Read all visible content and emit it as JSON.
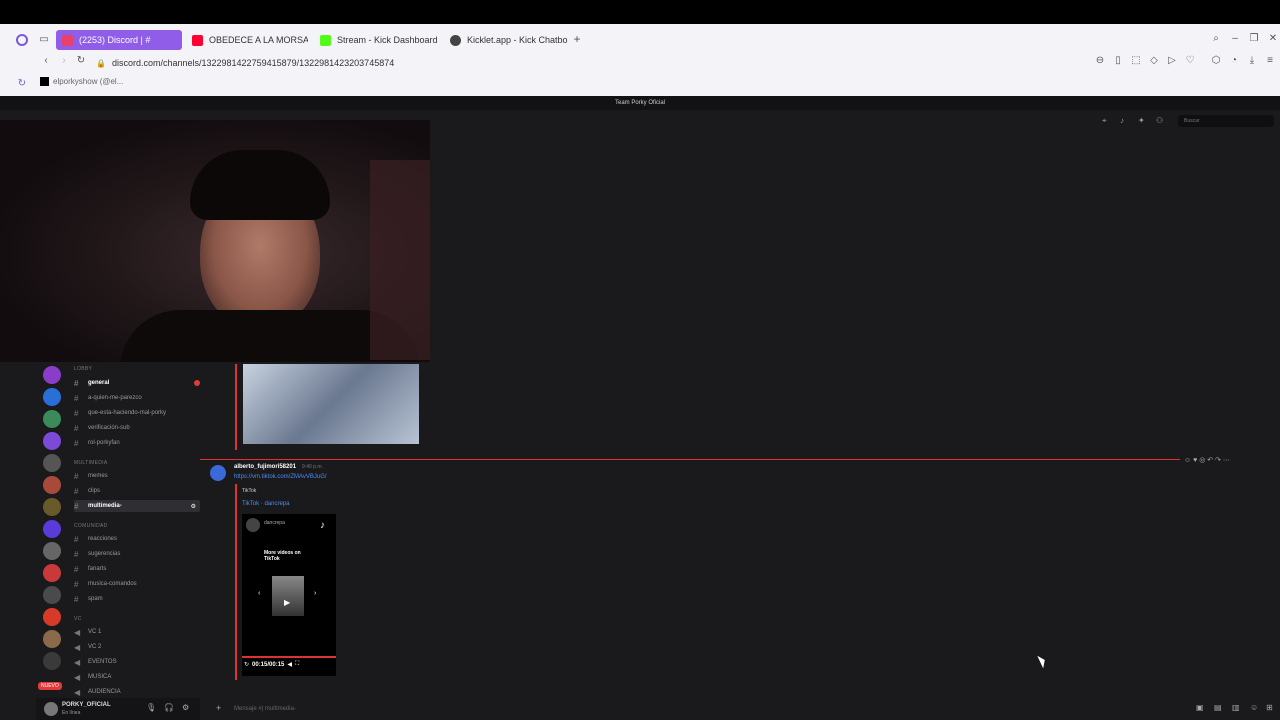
{
  "tabs": [
    {
      "label": "(2253) Discord | #",
      "active": true,
      "color": "#e8426b"
    },
    {
      "label": "OBEDECE A LA MORSA",
      "active": false,
      "color": "#ff0033"
    },
    {
      "label": "Stream - Kick Dashboard",
      "active": false,
      "color": "#53fc18"
    },
    {
      "label": "Kicklet.app - Kick Chatbo",
      "active": false,
      "color": "#444444"
    }
  ],
  "url": "discord.com/channels/1322981422759415879/1322981423203745874",
  "bookmark": "elporkyshow (@el...",
  "discord": {
    "window_title": "Team Porky Oficial",
    "search_placeholder": "Buscar",
    "categories": {
      "lobby": "LOBBY",
      "multimedia": "MULTIMEDIA",
      "comunidad": "COMUNIDAD",
      "vc": "VC"
    },
    "channels": {
      "general": "general",
      "a_quien": "a-quien-me-parezco",
      "que_esta": "que-esta-haciendo-mal-porky",
      "verificacion": "verificación-sub",
      "rol": "rol-porkyfan",
      "memes": "memes",
      "clips": "clips",
      "multimedia": "multimedia-",
      "reacciones": "reacciones",
      "sugerencias": "sugerencias",
      "fanarts": "fanarts",
      "musica": "musica-comandos",
      "spam": "spam",
      "vc1": "VC 1",
      "vc2": "VC 2",
      "eventos": "EVENTOS",
      "musica_vc": "MUSICA",
      "audiencia": "AUDIENCIA"
    },
    "nuevo_badge": "NUEVO",
    "user": {
      "name": "PORKY_OFICIAL",
      "status": "En línea"
    },
    "composer_placeholder": "Mensaje #| multimedia-",
    "message": {
      "author": "alberto_fujimori58201",
      "time": "9:40 p.m.",
      "link": "https://vm.tiktok.com/ZMAvVBJuG/",
      "embed_provider": "TikTok",
      "embed_title": "TikTok · dancrepa",
      "video_channel": "dancrepa",
      "video_text": "More videos on TikTok",
      "video_time": "00:15/00:15"
    }
  }
}
